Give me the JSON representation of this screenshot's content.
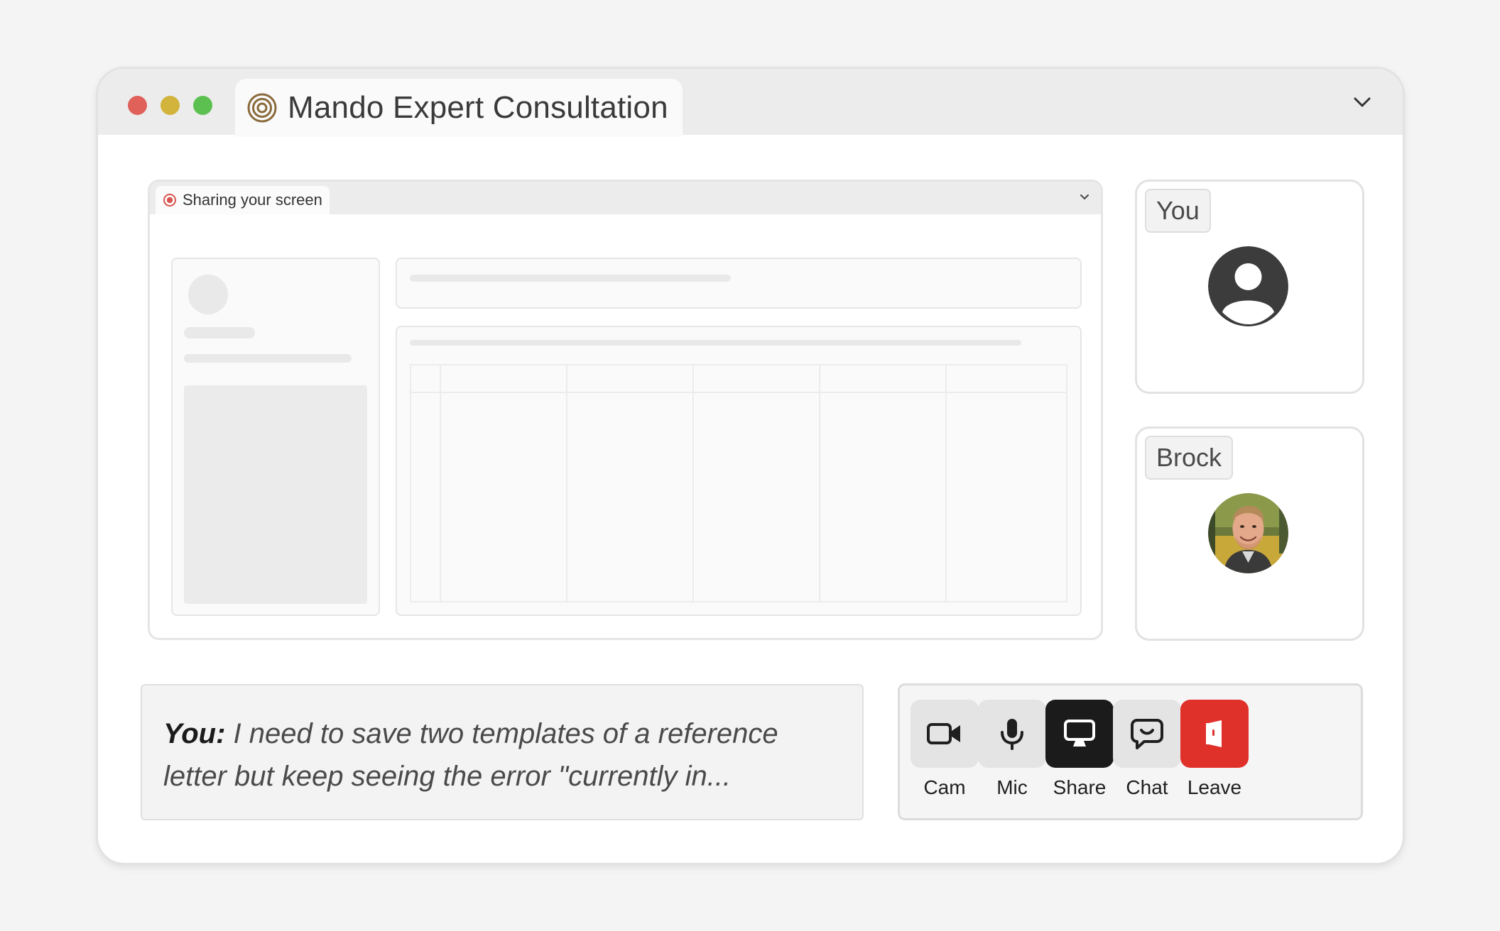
{
  "window": {
    "title": "Mando Expert Consultation",
    "controls": [
      "close",
      "minimize",
      "maximize"
    ],
    "menu_icon": "chevron-down-icon"
  },
  "screen_share": {
    "label": "Sharing your screen",
    "status_icon": "record-icon",
    "menu_icon": "chevron-down-icon"
  },
  "participants": [
    {
      "name": "You",
      "avatar": "user-placeholder-icon"
    },
    {
      "name": "Brock",
      "avatar": "photo"
    }
  ],
  "transcript": {
    "speaker": "You:",
    "text": "I need to save two templates of a reference letter but keep seeing the error \"currently in..."
  },
  "controls": {
    "cam_label": "Cam",
    "mic_label": "Mic",
    "share_label": "Share",
    "chat_label": "Chat",
    "leave_label": "Leave"
  },
  "colors": {
    "share_active": "#1b1b1b",
    "leave": "#e0302a",
    "traffic_red": "#e0605a",
    "traffic_yellow": "#d2b43c",
    "traffic_green": "#5cc051",
    "brand": "#8a6a3c"
  }
}
